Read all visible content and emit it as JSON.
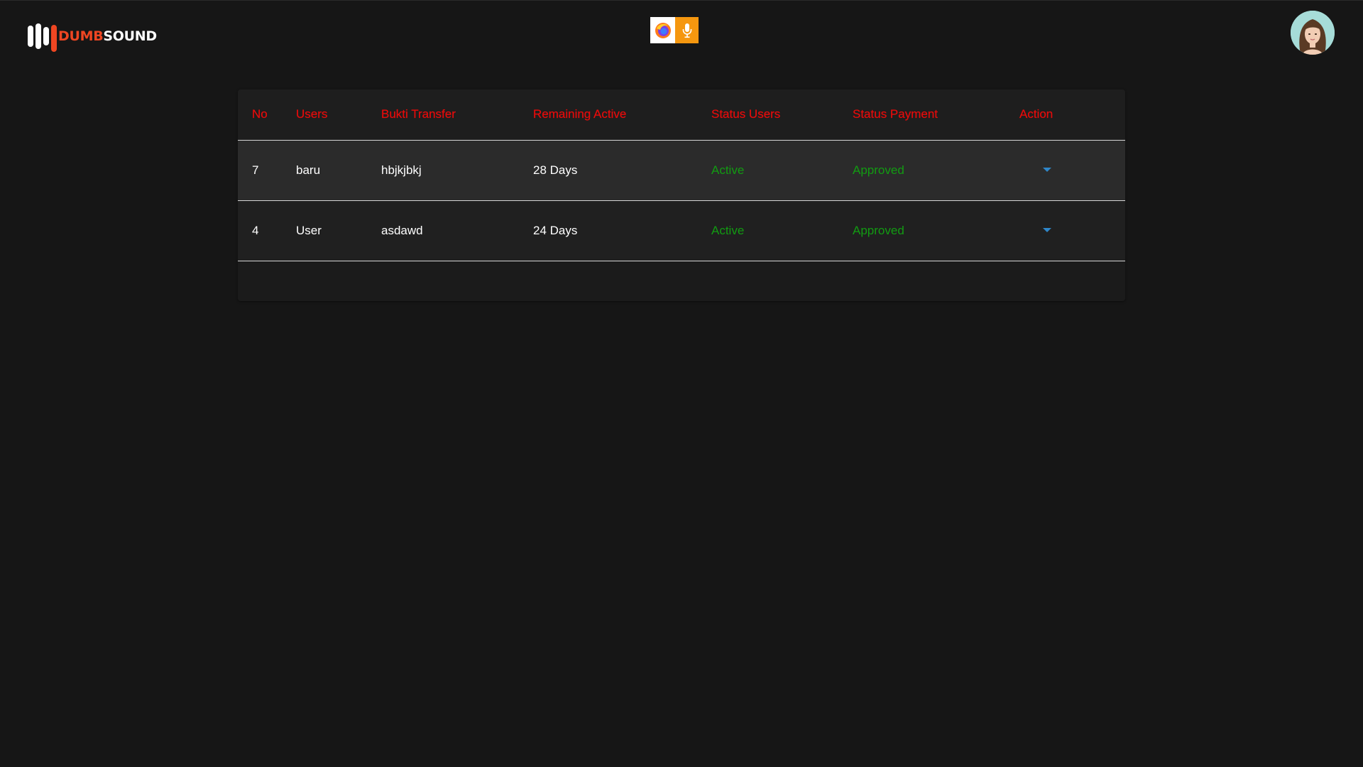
{
  "header": {
    "logo": {
      "part1": "DUMB",
      "part2": "SOUND"
    },
    "indicators": [
      "firefox-icon",
      "microphone-icon"
    ],
    "colors": {
      "brand": "#ee4622",
      "mic_indicator": "#f5970f"
    }
  },
  "table": {
    "columns": [
      "No",
      "Users",
      "Bukti Transfer",
      "Remaining Active",
      "Status Users",
      "Status Payment",
      "Action"
    ],
    "rows": [
      {
        "no": "7",
        "user": "baru",
        "bukti": "hbjkjbkj",
        "remaining": "28 Days",
        "status_user": "Active",
        "status_payment": "Approved"
      },
      {
        "no": "4",
        "user": "User",
        "bukti": "asdawd",
        "remaining": "24 Days",
        "status_user": "Active",
        "status_payment": "Approved"
      }
    ],
    "colors": {
      "header_text": "#e60b0b",
      "status_green": "#129b12",
      "action_icon": "#2f86c8"
    }
  }
}
